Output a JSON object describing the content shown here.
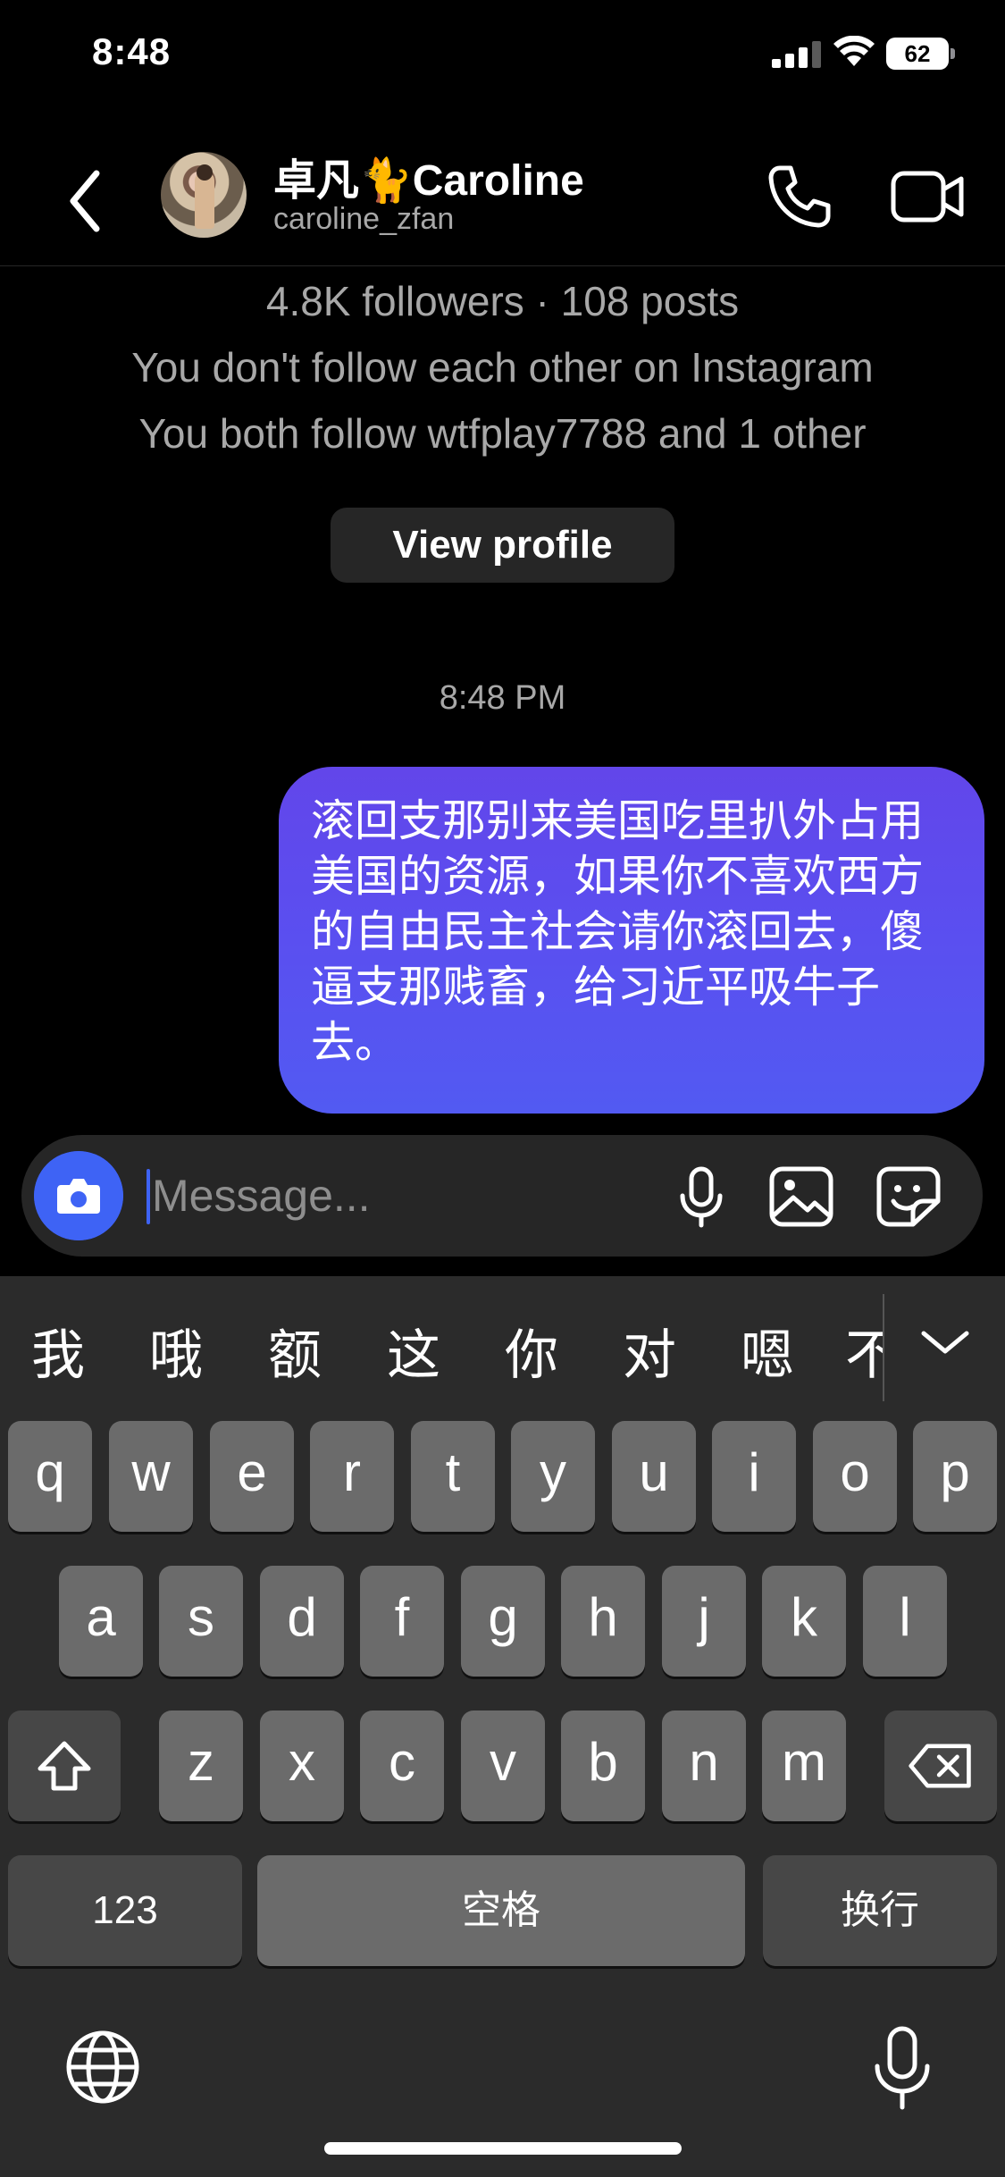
{
  "status_bar": {
    "time": "8:48",
    "battery": "62",
    "icons": [
      "cellular-signal-icon",
      "wifi-icon",
      "battery-icon"
    ]
  },
  "header": {
    "name": "卓凡🐈Caroline",
    "username": "caroline_zfan",
    "icons": [
      "back-chevron-icon",
      "phone-icon",
      "video-camera-icon"
    ]
  },
  "profile_info": {
    "stats": "4.8K followers · 108 posts",
    "follow_status": "You don't follow each other on Instagram",
    "mutual": "You both follow wtfplay7788 and 1 other",
    "view_profile_label": "View profile"
  },
  "conversation": {
    "timestamp": "8:48 PM",
    "messages": [
      {
        "sender": "me",
        "text": "滚回支那别来美国吃里扒外占用美国的资源，如果你不喜欢西方的自由民主社会请你滚回去，傻逼支那贱畜，给习近平吸牛子去。"
      }
    ]
  },
  "composer": {
    "placeholder": "Message...",
    "value": "",
    "icons": [
      "camera-icon",
      "microphone-icon",
      "gallery-icon",
      "sticker-icon"
    ]
  },
  "keyboard": {
    "candidates": [
      "我",
      "哦",
      "额",
      "这",
      "你",
      "对",
      "嗯",
      "不"
    ],
    "row1": [
      "q",
      "w",
      "e",
      "r",
      "t",
      "y",
      "u",
      "i",
      "o",
      "p"
    ],
    "row2": [
      "a",
      "s",
      "d",
      "f",
      "g",
      "h",
      "j",
      "k",
      "l"
    ],
    "row3": [
      "z",
      "x",
      "c",
      "v",
      "b",
      "n",
      "m"
    ],
    "numbers_label": "123",
    "space_label": "空格",
    "return_label": "换行",
    "icons": [
      "shift-icon",
      "backspace-icon",
      "globe-icon",
      "dictation-microphone-icon",
      "chevron-down-icon"
    ]
  },
  "colors": {
    "accent": "#3e63f5",
    "bubble_top": "#6246ea",
    "bubble_bottom": "#525af2",
    "background": "#000000"
  }
}
